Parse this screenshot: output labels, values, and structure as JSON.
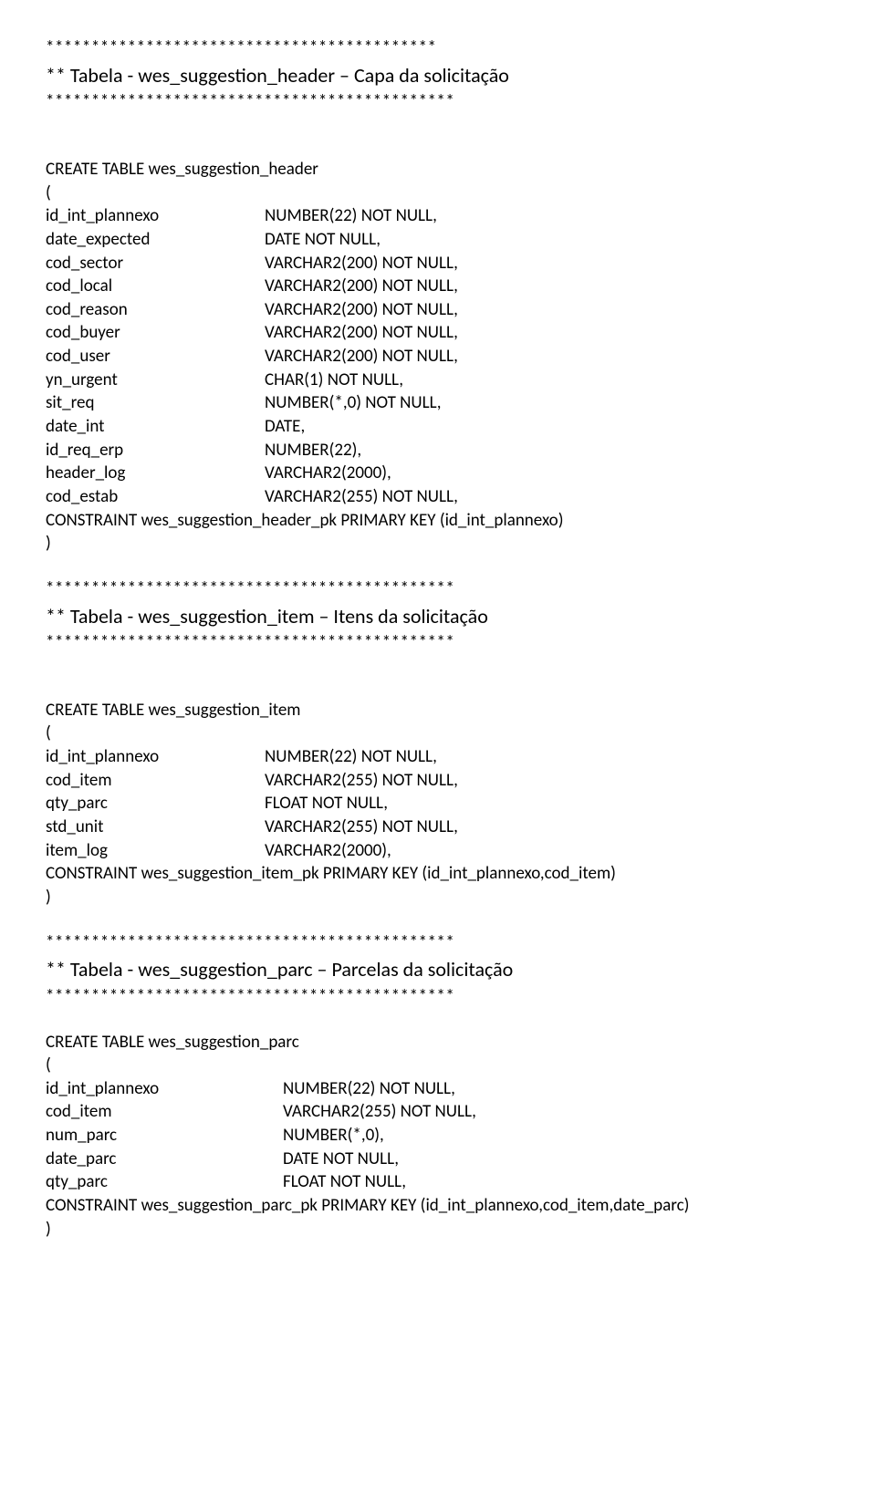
{
  "sep1": "*******************************************",
  "title1": "** Tabela - wes_suggestion_header – Capa da solicitação",
  "sep2": "*********************************************",
  "create1": "CREATE TABLE wes_suggestion_header",
  "open": "(",
  "close": ")",
  "cols1": [
    {
      "n": "id_int_plannexo",
      "t": " NUMBER(22) NOT NULL,"
    },
    {
      "n": "date_expected",
      "t": "DATE NOT NULL,"
    },
    {
      "n": "cod_sector",
      "t": "VARCHAR2(200) NOT NULL,"
    },
    {
      "n": "cod_local",
      "t": "VARCHAR2(200) NOT NULL,"
    },
    {
      "n": "cod_reason",
      "t": "VARCHAR2(200) NOT NULL,"
    },
    {
      "n": "cod_buyer",
      "t": "VARCHAR2(200) NOT NULL,"
    },
    {
      "n": "cod_user",
      "t": "VARCHAR2(200) NOT NULL,"
    },
    {
      "n": "yn_urgent",
      "t": " CHAR(1) NOT NULL,"
    },
    {
      "n": "sit_req",
      "t": "NUMBER(*,0) NOT NULL,"
    },
    {
      "n": "date_int",
      "t": "DATE,"
    },
    {
      "n": "id_req_erp",
      "t": "NUMBER(22),"
    },
    {
      "n": "header_log",
      "t": "VARCHAR2(2000),"
    },
    {
      "n": "cod_estab",
      "t": "VARCHAR2(255) NOT NULL,"
    }
  ],
  "constraint1": "CONSTRAINT wes_suggestion_header_pk PRIMARY KEY (id_int_plannexo)",
  "sep3": "*********************************************",
  "title2": "** Tabela  - wes_suggestion_item – Itens da solicitação",
  "sep4": "*********************************************",
  "create2": "CREATE TABLE wes_suggestion_item",
  "cols2": [
    {
      "n": "id_int_plannexo",
      "t": "NUMBER(22) NOT NULL,"
    },
    {
      "n": "cod_item",
      "t": "VARCHAR2(255) NOT NULL,"
    },
    {
      "n": "qty_parc",
      "t": " FLOAT NOT NULL,"
    },
    {
      "n": "std_unit",
      "t": "VARCHAR2(255) NOT NULL,"
    },
    {
      "n": "item_log",
      "t": "VARCHAR2(2000),"
    }
  ],
  "constraint2": "CONSTRAINT wes_suggestion_item_pk PRIMARY KEY (id_int_plannexo,cod_item)",
  "sep5": "*********************************************",
  "title3": "** Tabela  - wes_suggestion_parc – Parcelas da solicitação",
  "sep6": "*********************************************",
  "create3": "CREATE TABLE wes_suggestion_parc",
  "cols3": [
    {
      "n": "id_int_plannexo",
      "t": "NUMBER(22) NOT NULL,"
    },
    {
      "n": "cod_item",
      "t": "VARCHAR2(255) NOT NULL,"
    },
    {
      "n": "num_parc",
      "t": "NUMBER(*,0),"
    },
    {
      "n": "date_parc",
      "t": "DATE NOT NULL,"
    },
    {
      "n": "qty_parc",
      "t": "FLOAT NOT NULL,"
    }
  ],
  "constraint3": "CONSTRAINT wes_suggestion_parc_pk PRIMARY KEY (id_int_plannexo,cod_item,date_parc)"
}
